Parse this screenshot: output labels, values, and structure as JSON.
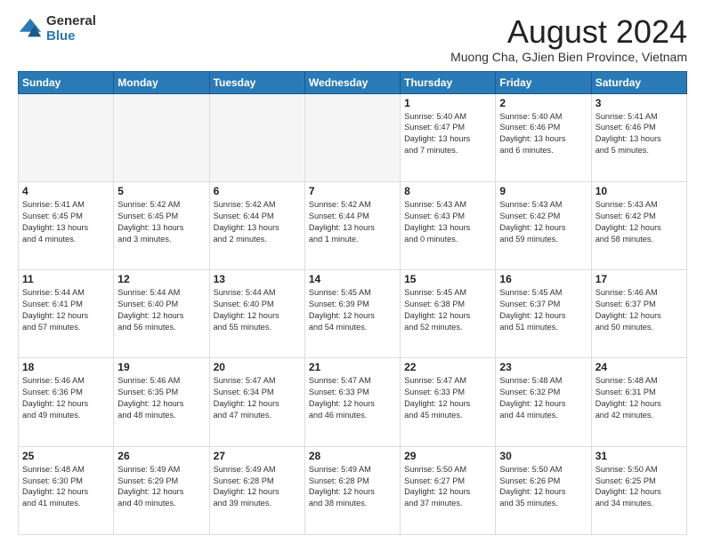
{
  "logo": {
    "general": "General",
    "blue": "Blue"
  },
  "title": "August 2024",
  "subtitle": "Muong Cha, GJien Bien Province, Vietnam",
  "days": [
    "Sunday",
    "Monday",
    "Tuesday",
    "Wednesday",
    "Thursday",
    "Friday",
    "Saturday"
  ],
  "weeks": [
    [
      {
        "num": "",
        "info": ""
      },
      {
        "num": "",
        "info": ""
      },
      {
        "num": "",
        "info": ""
      },
      {
        "num": "",
        "info": ""
      },
      {
        "num": "1",
        "info": "Sunrise: 5:40 AM\nSunset: 6:47 PM\nDaylight: 13 hours\nand 7 minutes."
      },
      {
        "num": "2",
        "info": "Sunrise: 5:40 AM\nSunset: 6:46 PM\nDaylight: 13 hours\nand 6 minutes."
      },
      {
        "num": "3",
        "info": "Sunrise: 5:41 AM\nSunset: 6:46 PM\nDaylight: 13 hours\nand 5 minutes."
      }
    ],
    [
      {
        "num": "4",
        "info": "Sunrise: 5:41 AM\nSunset: 6:45 PM\nDaylight: 13 hours\nand 4 minutes."
      },
      {
        "num": "5",
        "info": "Sunrise: 5:42 AM\nSunset: 6:45 PM\nDaylight: 13 hours\nand 3 minutes."
      },
      {
        "num": "6",
        "info": "Sunrise: 5:42 AM\nSunset: 6:44 PM\nDaylight: 13 hours\nand 2 minutes."
      },
      {
        "num": "7",
        "info": "Sunrise: 5:42 AM\nSunset: 6:44 PM\nDaylight: 13 hours\nand 1 minute."
      },
      {
        "num": "8",
        "info": "Sunrise: 5:43 AM\nSunset: 6:43 PM\nDaylight: 13 hours\nand 0 minutes."
      },
      {
        "num": "9",
        "info": "Sunrise: 5:43 AM\nSunset: 6:42 PM\nDaylight: 12 hours\nand 59 minutes."
      },
      {
        "num": "10",
        "info": "Sunrise: 5:43 AM\nSunset: 6:42 PM\nDaylight: 12 hours\nand 58 minutes."
      }
    ],
    [
      {
        "num": "11",
        "info": "Sunrise: 5:44 AM\nSunset: 6:41 PM\nDaylight: 12 hours\nand 57 minutes."
      },
      {
        "num": "12",
        "info": "Sunrise: 5:44 AM\nSunset: 6:40 PM\nDaylight: 12 hours\nand 56 minutes."
      },
      {
        "num": "13",
        "info": "Sunrise: 5:44 AM\nSunset: 6:40 PM\nDaylight: 12 hours\nand 55 minutes."
      },
      {
        "num": "14",
        "info": "Sunrise: 5:45 AM\nSunset: 6:39 PM\nDaylight: 12 hours\nand 54 minutes."
      },
      {
        "num": "15",
        "info": "Sunrise: 5:45 AM\nSunset: 6:38 PM\nDaylight: 12 hours\nand 52 minutes."
      },
      {
        "num": "16",
        "info": "Sunrise: 5:45 AM\nSunset: 6:37 PM\nDaylight: 12 hours\nand 51 minutes."
      },
      {
        "num": "17",
        "info": "Sunrise: 5:46 AM\nSunset: 6:37 PM\nDaylight: 12 hours\nand 50 minutes."
      }
    ],
    [
      {
        "num": "18",
        "info": "Sunrise: 5:46 AM\nSunset: 6:36 PM\nDaylight: 12 hours\nand 49 minutes."
      },
      {
        "num": "19",
        "info": "Sunrise: 5:46 AM\nSunset: 6:35 PM\nDaylight: 12 hours\nand 48 minutes."
      },
      {
        "num": "20",
        "info": "Sunrise: 5:47 AM\nSunset: 6:34 PM\nDaylight: 12 hours\nand 47 minutes."
      },
      {
        "num": "21",
        "info": "Sunrise: 5:47 AM\nSunset: 6:33 PM\nDaylight: 12 hours\nand 46 minutes."
      },
      {
        "num": "22",
        "info": "Sunrise: 5:47 AM\nSunset: 6:33 PM\nDaylight: 12 hours\nand 45 minutes."
      },
      {
        "num": "23",
        "info": "Sunrise: 5:48 AM\nSunset: 6:32 PM\nDaylight: 12 hours\nand 44 minutes."
      },
      {
        "num": "24",
        "info": "Sunrise: 5:48 AM\nSunset: 6:31 PM\nDaylight: 12 hours\nand 42 minutes."
      }
    ],
    [
      {
        "num": "25",
        "info": "Sunrise: 5:48 AM\nSunset: 6:30 PM\nDaylight: 12 hours\nand 41 minutes."
      },
      {
        "num": "26",
        "info": "Sunrise: 5:49 AM\nSunset: 6:29 PM\nDaylight: 12 hours\nand 40 minutes."
      },
      {
        "num": "27",
        "info": "Sunrise: 5:49 AM\nSunset: 6:28 PM\nDaylight: 12 hours\nand 39 minutes."
      },
      {
        "num": "28",
        "info": "Sunrise: 5:49 AM\nSunset: 6:28 PM\nDaylight: 12 hours\nand 38 minutes."
      },
      {
        "num": "29",
        "info": "Sunrise: 5:50 AM\nSunset: 6:27 PM\nDaylight: 12 hours\nand 37 minutes."
      },
      {
        "num": "30",
        "info": "Sunrise: 5:50 AM\nSunset: 6:26 PM\nDaylight: 12 hours\nand 35 minutes."
      },
      {
        "num": "31",
        "info": "Sunrise: 5:50 AM\nSunset: 6:25 PM\nDaylight: 12 hours\nand 34 minutes."
      }
    ]
  ]
}
